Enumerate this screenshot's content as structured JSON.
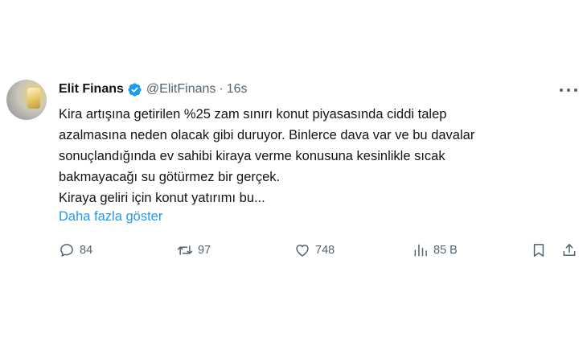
{
  "tweet": {
    "author_name": "Elit Finans",
    "handle": "@ElitFinans",
    "separator": "·",
    "time": "16s",
    "text_lines": [
      "Kira artışına getirilen %25 zam sınırı konut piyasasında ciddi talep",
      "azalmasına neden olacak gibi duruyor. Binlerce dava var ve bu davalar",
      "sonuçlandığında ev sahibi kiraya verme konusuna kesinlikle sıcak",
      "bakmayacağı su götürmez bir gerçek.",
      "Kiraya geliri için konut yatırımı bu..."
    ],
    "show_more": "Daha fazla göster"
  },
  "actions": {
    "replies": "84",
    "retweets": "97",
    "likes": "748",
    "views": "85 B"
  },
  "icons": [
    "verified-badge-icon",
    "more-icon",
    "reply-icon",
    "retweet-icon",
    "like-icon",
    "views-icon",
    "bookmark-icon",
    "share-icon"
  ],
  "colors": {
    "text": "#0f1419",
    "secondary": "#536471",
    "link": "#1d9bf0",
    "verified": "#1d9bf0"
  }
}
